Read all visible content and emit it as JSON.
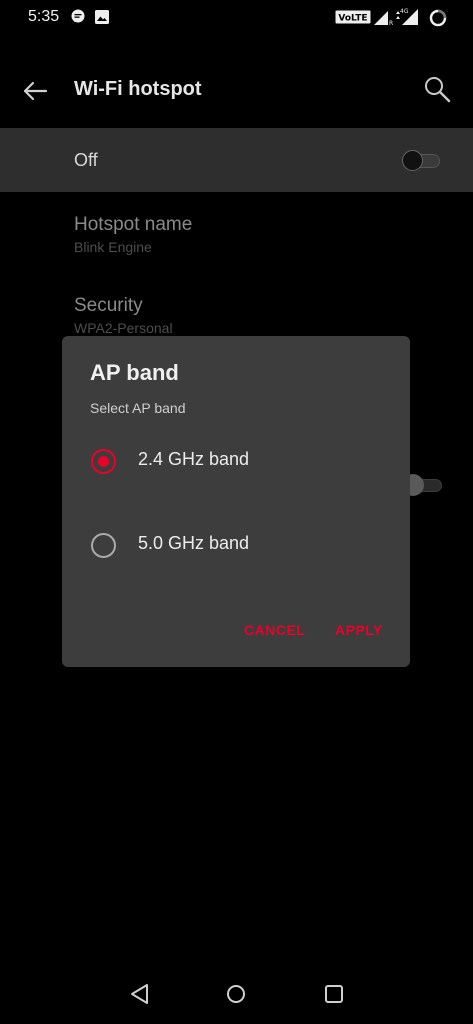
{
  "status_bar": {
    "time": "5:35",
    "volte_label": "VoLTE",
    "network_label": "4G",
    "icons": [
      "message-icon",
      "image-icon",
      "volte-icon",
      "signal-icon",
      "signal-4g-icon",
      "battery-icon"
    ]
  },
  "app_bar": {
    "title": "Wi-Fi hotspot",
    "back_icon": "arrow-back-icon",
    "search_icon": "search-icon"
  },
  "main_toggle": {
    "label": "Off",
    "state": "off"
  },
  "settings": [
    {
      "title": "Hotspot name",
      "subtitle": "Blink Engine"
    },
    {
      "title": "Security",
      "subtitle": "WPA2-Personal"
    }
  ],
  "dialog": {
    "title": "AP band",
    "subtitle": "Select AP band",
    "options": [
      {
        "label": "2.4 GHz band",
        "selected": true
      },
      {
        "label": "5.0 GHz band",
        "selected": false
      }
    ],
    "cancel_label": "CANCEL",
    "apply_label": "APPLY",
    "accent_color": "#eb0028"
  },
  "nav_bar": {
    "icons": [
      "nav-back-icon",
      "nav-home-icon",
      "nav-recents-icon"
    ]
  },
  "colors": {
    "background": "#000000",
    "row_highlight": "#2e2e2e",
    "dialog_bg": "#3d3d3d",
    "accent": "#eb0028"
  }
}
